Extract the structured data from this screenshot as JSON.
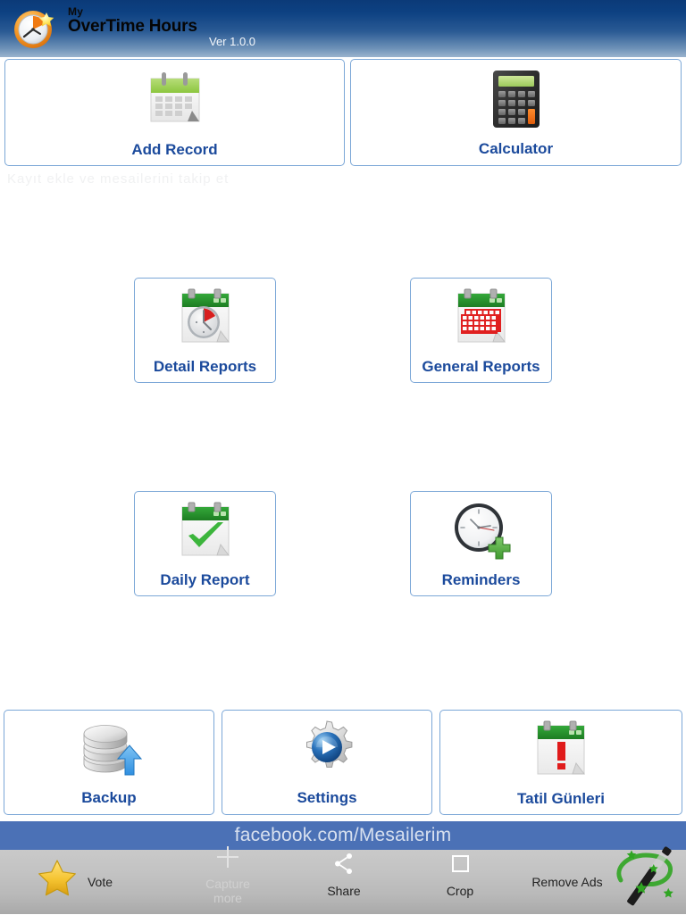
{
  "header": {
    "title_small": "My",
    "title_main": "OverTime Hours",
    "version": "Ver 1.0.0",
    "logo_icon": "clock-star-icon",
    "gradient_top": "#0b3a78",
    "gradient_bottom": "#9ab3cd"
  },
  "watermark": {
    "text": "Kayıt ekle ve mesailerini takip et"
  },
  "menu": {
    "label_color": "#1b4a9c",
    "border_color": "#7ba7d7",
    "items": [
      {
        "id": "add-record",
        "label": "Add Record",
        "icon": "calendar-spiral-icon"
      },
      {
        "id": "calculator",
        "label": "Calculator",
        "icon": "calculator-icon"
      },
      {
        "id": "detail-reports",
        "label": "Detail Reports",
        "icon": "calendar-clock-icon"
      },
      {
        "id": "general-reports",
        "label": "General Reports",
        "icon": "calendar-grid-icon"
      },
      {
        "id": "daily-report",
        "label": "Daily Report",
        "icon": "calendar-check-icon"
      },
      {
        "id": "reminders",
        "label": "Reminders",
        "icon": "clock-plus-icon"
      },
      {
        "id": "backup",
        "label": "Backup",
        "icon": "database-upload-icon"
      },
      {
        "id": "settings",
        "label": "Settings",
        "icon": "gear-play-icon"
      },
      {
        "id": "tatil-gunleri",
        "label": "Tatil Günleri",
        "icon": "calendar-exclamation-icon"
      }
    ]
  },
  "ad": {
    "text": "facebook.com/Mesailerim",
    "background": "#4b71b6"
  },
  "toolbar": {
    "vote": {
      "label": "Vote",
      "icon": "star-icon"
    },
    "capture": {
      "label_line1": "Capture",
      "label_line2": "more",
      "icon": "plus-crosshair-icon"
    },
    "share": {
      "label": "Share",
      "icon": "share-icon"
    },
    "crop": {
      "label": "Crop",
      "icon": "crop-icon"
    },
    "remove_ads": {
      "label": "Remove Ads",
      "icon": "magic-wand-icon"
    }
  }
}
